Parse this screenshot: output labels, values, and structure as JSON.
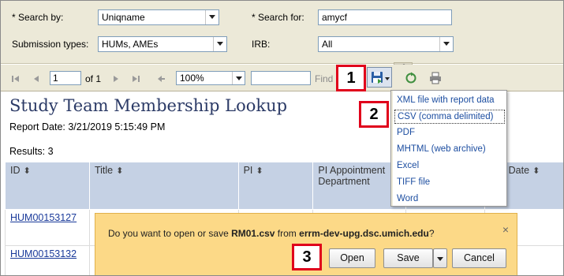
{
  "params": {
    "search_by_label": "* Search by:",
    "search_by_value": "Uniqname",
    "search_for_label": "* Search for:",
    "search_for_value": "amycf",
    "submission_types_label": "Submission types:",
    "submission_types_value": "HUMs, AMEs",
    "irb_label": "IRB:",
    "irb_value": "All"
  },
  "toolbar": {
    "page_value": "1",
    "page_of": "of 1",
    "zoom_value": "100%",
    "find_value": "",
    "find_label": "Find"
  },
  "report": {
    "title": "Study Team Membership Lookup",
    "date": "Report Date: 3/21/2019 5:15:49 PM",
    "results": "Results: 3"
  },
  "table": {
    "columns": [
      {
        "label": "ID",
        "sort": "⬍"
      },
      {
        "label": "Title",
        "sort": "⬍"
      },
      {
        "label": "PI",
        "sort": "⬍"
      },
      {
        "label": "PI Appointment Department",
        "sort": ""
      },
      {
        "label": "",
        "sort": ""
      },
      {
        "label": "dy . Date",
        "sort": "⬍"
      }
    ],
    "rows": [
      {
        "id": "HUM00153127"
      },
      {
        "id": "HUM00153132"
      }
    ]
  },
  "export_menu": {
    "items": [
      "XML file with report data",
      "CSV (comma delimited)",
      "PDF",
      "MHTML (web archive)",
      "Excel",
      "TIFF file",
      "Word"
    ],
    "highlighted_index": 1
  },
  "notification": {
    "prefix": "Do you want to open or save ",
    "filename": "RM01.csv",
    "middle": " from ",
    "host": "errm-dev-upg.dsc.umich.edu",
    "suffix": "?",
    "close": "×",
    "open_label": "Open",
    "save_label": "Save",
    "cancel_label": "Cancel"
  },
  "callouts": [
    "1",
    "2",
    "3"
  ],
  "colors": {
    "toolbar_bg": "#ece9d8",
    "header_bg": "#c5d1e4",
    "link": "#1a3a9a",
    "notification_bg": "#fcd987",
    "callout_border": "#e0001b",
    "title": "#2b3a66"
  }
}
